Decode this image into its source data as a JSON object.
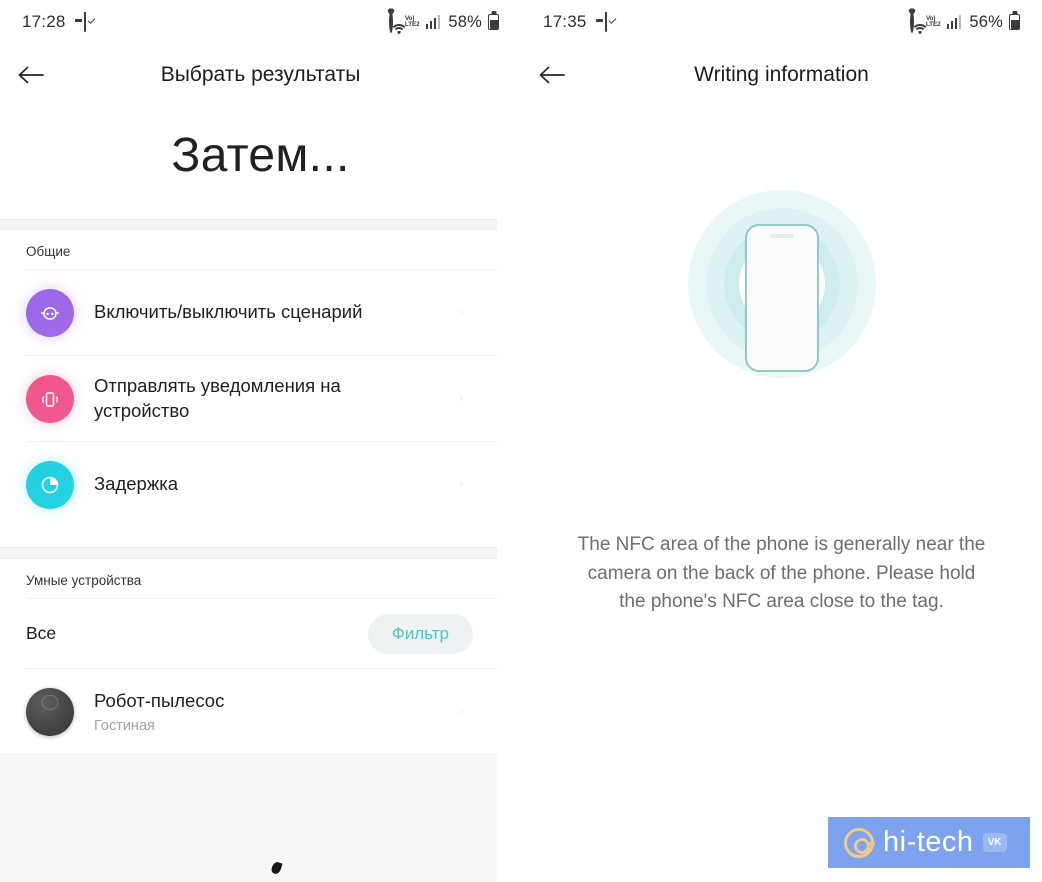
{
  "left": {
    "status_bar": {
      "time": "17:28",
      "battery_percent": "58%",
      "network_label": "VoLTE2",
      "volte_top": "Vo)",
      "volte_bottom": "LTE2",
      "icons": [
        "folder-icon",
        "shield-icon",
        "picture-icon",
        "alarm-icon",
        "wifi-icon",
        "volte-icon",
        "signal-bars-icon",
        "battery-icon"
      ]
    },
    "appbar": {
      "title": "Выбрать результаты",
      "back_icon": "back-arrow-icon"
    },
    "big_title": "Затем...",
    "section_general": {
      "label": "Общие",
      "rows": [
        {
          "title": "Включить/выключить сценарий",
          "icon": "scenario-robot-icon",
          "color": "#a06ae6"
        },
        {
          "title": "Отправлять уведомления на устройство",
          "icon": "phone-vibrate-icon",
          "color": "#ef5a93"
        },
        {
          "title": "Задержка",
          "icon": "delay-timer-icon",
          "color": "#27d3e2"
        }
      ]
    },
    "section_devices": {
      "label": "Умные устройства",
      "all_label": "Все",
      "filter_label": "Фильтр",
      "devices": [
        {
          "title": "Робот-пылесос",
          "room": "Гостиная",
          "icon": "robot-vacuum-avatar"
        }
      ]
    }
  },
  "right": {
    "status_bar": {
      "time": "17:35",
      "battery_percent": "56%",
      "volte_top": "Vo)",
      "volte_bottom": "LTE2"
    },
    "appbar": {
      "title": "Writing information",
      "back_icon": "back-arrow-icon"
    },
    "illustration": {
      "name": "nfc-phone-waves-illustration"
    },
    "description": "The NFC area of the phone is generally near the camera on the back of the phone. Please hold the phone's NFC area close to the tag."
  },
  "watermark": {
    "text": "hi-tech",
    "badge": "VK",
    "at_icon": "at-sign-icon",
    "bg_color": "#7da3ee"
  },
  "colors": {
    "accent_teal": "#4fc3c9",
    "purple": "#a06ae6",
    "pink": "#ef5a93",
    "cyan": "#27d3e2",
    "text_primary": "#1f1f1f",
    "text_secondary": "#a3a3a3"
  }
}
